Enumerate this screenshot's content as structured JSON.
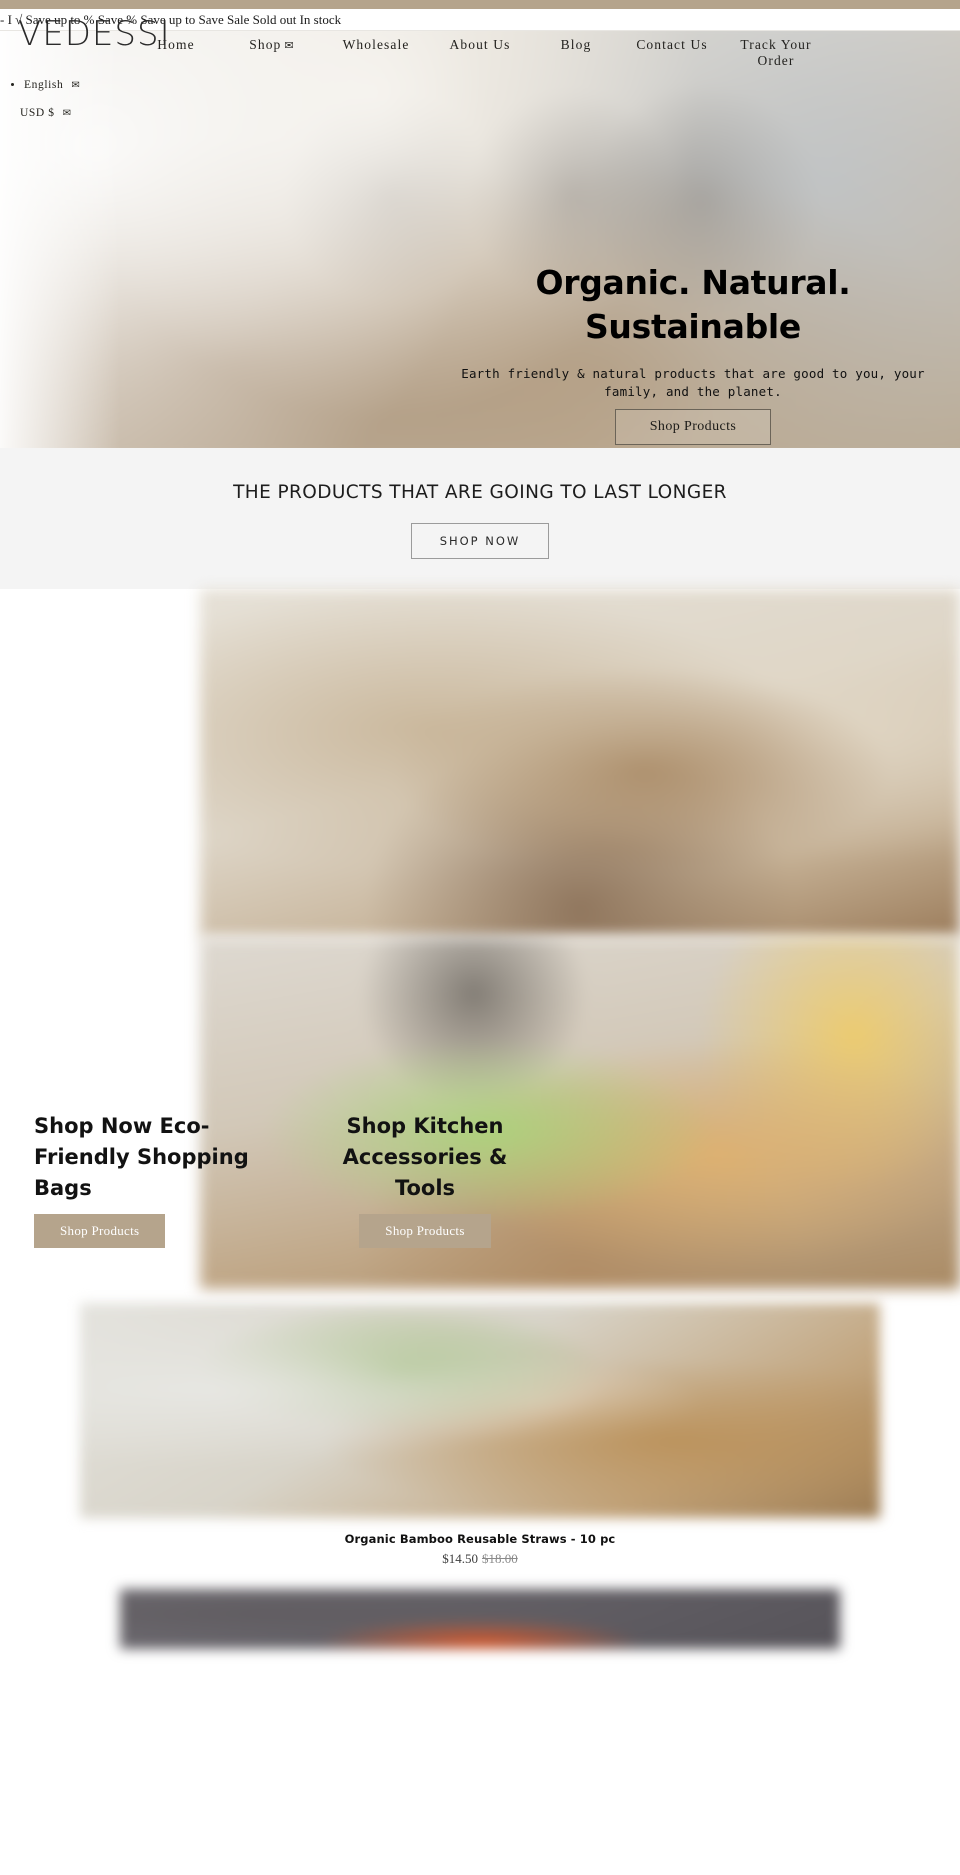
{
  "theme": {
    "accent": "#b5a48c",
    "promo_bg": "#f4f4f4",
    "text_dark": "#111111"
  },
  "announcement": {
    "text": "- I √ Save up to % Save % Save up to Save Sale Sold out In stock"
  },
  "brand": {
    "logo_text": "VEDESSI"
  },
  "nav": {
    "items": [
      {
        "label": "Home",
        "caret": ""
      },
      {
        "label": "Shop",
        "caret": "✉"
      },
      {
        "label": "Wholesale",
        "caret": ""
      },
      {
        "label": "About Us",
        "caret": ""
      },
      {
        "label": "Blog",
        "caret": ""
      },
      {
        "label": "Contact Us",
        "caret": ""
      },
      {
        "label": "Track Your Order",
        "caret": ""
      }
    ]
  },
  "locale": {
    "language": "English",
    "language_caret": "✉",
    "currency": "USD $",
    "currency_caret": "✉"
  },
  "hero": {
    "title_line1": "Organic. Natural.",
    "title_line2": "Sustainable",
    "subtitle_line1": "Earth friendly & natural products that are good to you, your",
    "subtitle_line2": "family, and the planet.",
    "cta": "Shop Products"
  },
  "promo": {
    "title": "THE PRODUCTS THAT ARE GOING TO LAST LONGER",
    "cta": "SHOP NOW"
  },
  "collections": [
    {
      "heading": "Shop Now Eco-Friendly Shopping Bags",
      "cta": "Shop Products"
    },
    {
      "heading": "Shop Kitchen Accessories & Tools",
      "cta": "Shop Products"
    }
  ],
  "products": [
    {
      "title": "Organic Bamboo Reusable Straws - 10 pc",
      "price": "$14.50",
      "compare_at_price": "$18.00"
    }
  ]
}
